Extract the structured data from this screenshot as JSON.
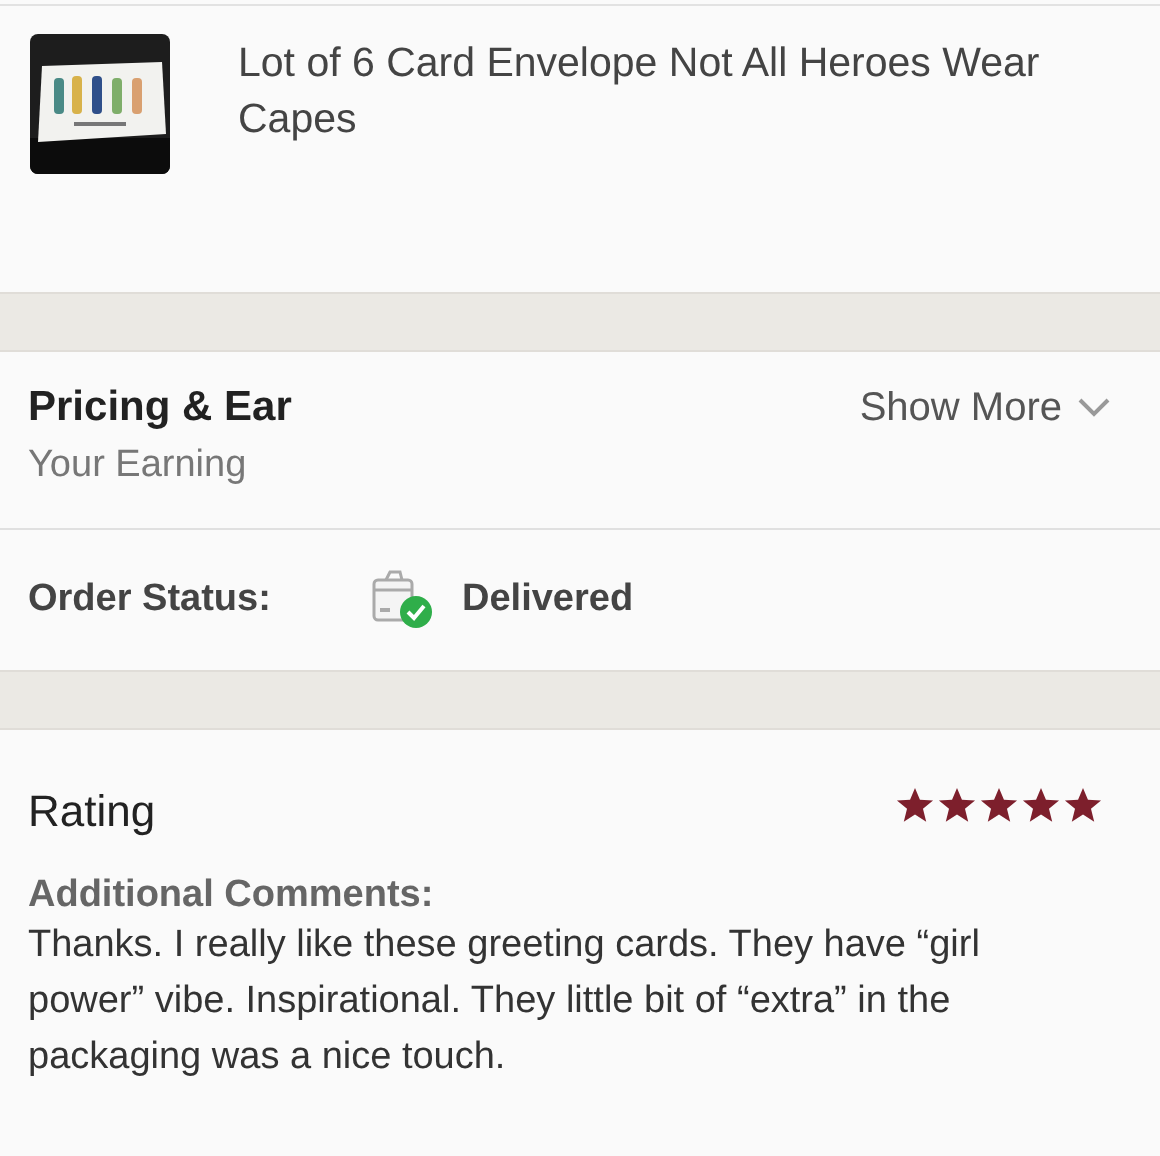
{
  "product": {
    "title": "Lot of 6 Card Envelope Not All Heroes Wear Capes"
  },
  "pricing": {
    "title": "Pricing & Ear",
    "subtitle": "Your Earning",
    "toggle": "Show More",
    "expanded": false
  },
  "order_status": {
    "label": "Order Status:",
    "value": "Delivered"
  },
  "rating": {
    "label": "Rating",
    "stars": 5
  },
  "comments": {
    "label": "Additional Comments:",
    "text": "Thanks. I really like these greeting cards. They have “girl power” vibe. Inspirational. They little bit of “extra” in the packaging was a nice touch."
  }
}
